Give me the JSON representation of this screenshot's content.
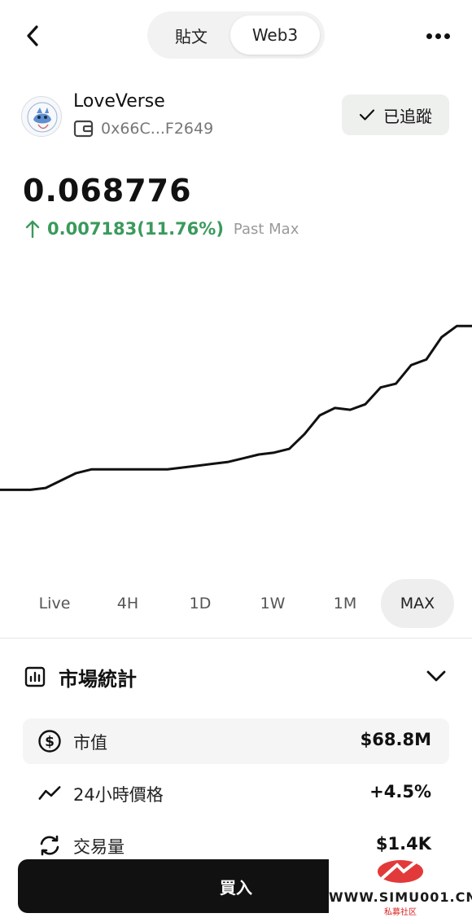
{
  "header": {
    "tabs": [
      {
        "label": "貼文",
        "active": false
      },
      {
        "label": "Web3",
        "active": true
      }
    ],
    "back_icon": "chevron-left-icon",
    "more_icon": "more-horizontal-icon"
  },
  "project": {
    "name": "LoveVerse",
    "wallet_icon": "wallet-icon",
    "wallet_address": "0x66C...F2649",
    "follow_label": "已追蹤",
    "follow_icon": "check-icon"
  },
  "price": {
    "value": "0.068776",
    "change": "0.007183(11.76%)",
    "change_direction": "up",
    "period": "Past Max",
    "up_color": "#3a9a5b"
  },
  "chart_data": {
    "type": "line",
    "title": "",
    "xlabel": "",
    "ylabel": "",
    "x": [
      0,
      1,
      2,
      3,
      4,
      5,
      6,
      7,
      8,
      9,
      10,
      11,
      12,
      13,
      14,
      15,
      16,
      17,
      18,
      19,
      20,
      21,
      22,
      23,
      24,
      25,
      26,
      27,
      28,
      29,
      30,
      31
    ],
    "series": [
      {
        "values": [
          0.06,
          0.06,
          0.06,
          0.0601,
          0.0605,
          0.0609,
          0.0611,
          0.0611,
          0.0611,
          0.0611,
          0.0611,
          0.0611,
          0.0612,
          0.0613,
          0.0614,
          0.0615,
          0.0617,
          0.0619,
          0.062,
          0.0622,
          0.063,
          0.064,
          0.0644,
          0.0643,
          0.0646,
          0.0655,
          0.0657,
          0.0667,
          0.067,
          0.0682,
          0.0688,
          0.0688
        ]
      }
    ],
    "line_color": "#111111",
    "grid": false,
    "ylim": [
      0.057,
      0.071
    ]
  },
  "ranges": [
    {
      "label": "Live",
      "active": false
    },
    {
      "label": "4H",
      "active": false
    },
    {
      "label": "1D",
      "active": false
    },
    {
      "label": "1W",
      "active": false
    },
    {
      "label": "1M",
      "active": false
    },
    {
      "label": "MAX",
      "active": true
    }
  ],
  "market": {
    "title": "市場統計",
    "title_icon": "bar-chart-icon",
    "collapse_icon": "chevron-down-icon",
    "stats": [
      {
        "icon": "dollar-circle-icon",
        "label": "市值",
        "value": "$68.8M"
      },
      {
        "icon": "trend-line-icon",
        "label": "24小時價格",
        "value": "+4.5%"
      },
      {
        "icon": "refresh-arrows-icon",
        "label": "交易量",
        "value": "$1.4K"
      }
    ]
  },
  "buy": {
    "label": "買入"
  },
  "watermark": {
    "text": "WWW.SIMU001.CN",
    "sub": "私募社区"
  }
}
